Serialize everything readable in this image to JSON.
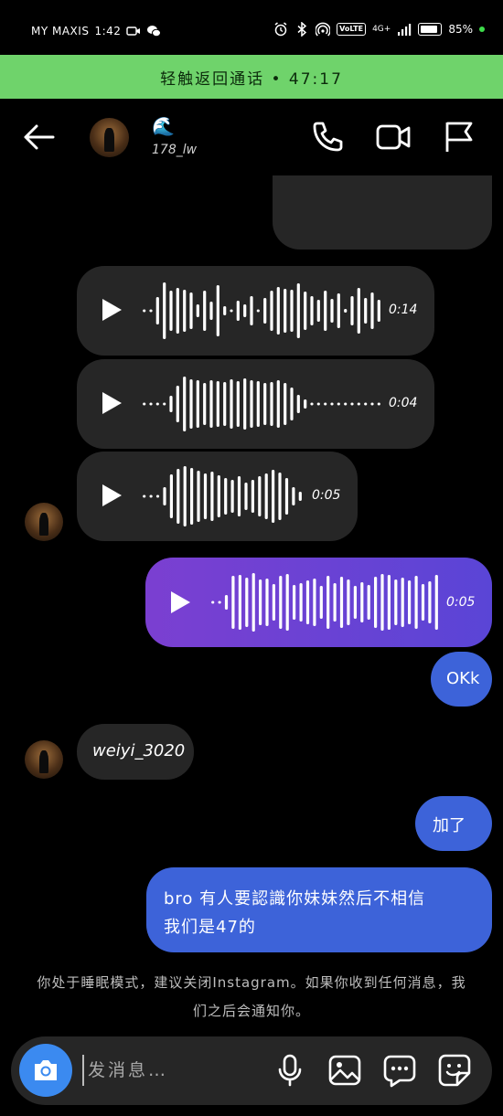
{
  "status_bar": {
    "carrier": "MY MAXIS",
    "time": "1:42",
    "volte": "VoLTE",
    "network": "4G+",
    "battery": "85%"
  },
  "call_banner": {
    "text": "轻触返回通话 • 47:17"
  },
  "header": {
    "emoji": "🌊",
    "username": "178_lw"
  },
  "messages": {
    "voice1": {
      "duration": "0:14"
    },
    "voice2": {
      "duration": "0:04"
    },
    "voice3": {
      "duration": "0:05"
    },
    "voice_sent": {
      "duration": "0:05"
    },
    "okk": "OKk",
    "weiyi": "weiyi_3020",
    "jiale": "加了",
    "long_line1": "bro 有人要認識你妹妹然后不相信",
    "long_line2": "我们是47的"
  },
  "notice": {
    "line1": "你处于睡眠模式，建议关闭Instagram。如果你收到任何消息，我",
    "line2": "们之后会通知你。"
  },
  "composer": {
    "placeholder": "发消息…"
  },
  "colors": {
    "call_banner": "#6fd36b",
    "sent_blue": "#3d63d9",
    "sent_purple": "#7b3fd1",
    "received": "#262626",
    "camera": "#3b8af0"
  }
}
